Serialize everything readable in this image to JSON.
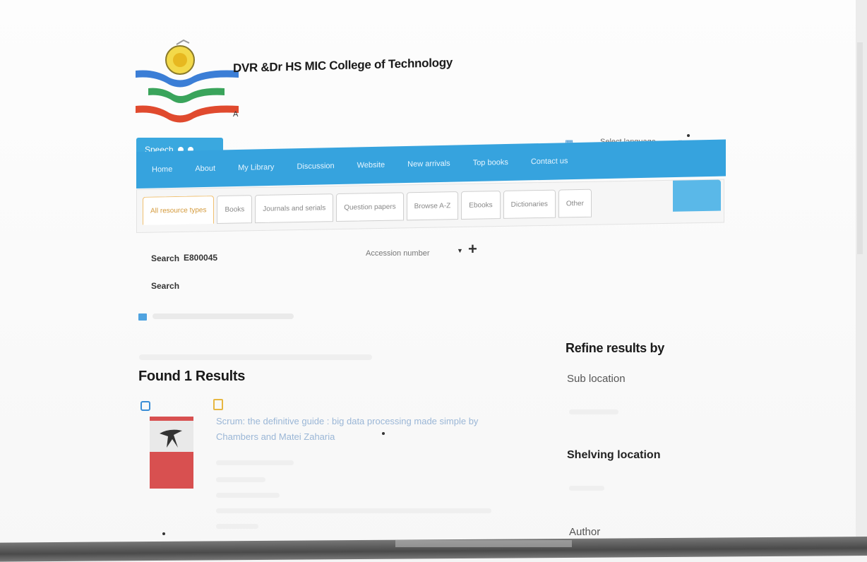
{
  "header": {
    "college_name": "DVR &Dr HS MIC College of Technology",
    "logo_letter": "A"
  },
  "speech": {
    "label": "Speech"
  },
  "language": {
    "placeholder": "Select language"
  },
  "nav": {
    "items": [
      "Home",
      "About",
      "My Library",
      "Discussion",
      "Website",
      "New arrivals",
      "Top books",
      "Contact us"
    ]
  },
  "tabs": {
    "items": [
      "All resource types",
      "Books",
      "Journals and serials",
      "Question papers",
      "Browse A-Z",
      "Ebooks",
      "Dictionaries",
      "Other"
    ]
  },
  "search": {
    "label": "Search",
    "value": "E800045",
    "field": "Accession number",
    "button_label": "Search"
  },
  "results": {
    "title": "Found 1 Results",
    "items": [
      {
        "title": "Scrum: the definitive guide : big data processing made simple by Chambers and Matei Zaharia"
      }
    ]
  },
  "sidebar": {
    "title": "Refine results by",
    "facets": [
      "Sub location",
      "Shelving location",
      "Author"
    ]
  },
  "colors": {
    "nav": "#36a3de",
    "accent": "#3aa8df",
    "tab_active": "#d49a3b",
    "cover": "#d85050"
  }
}
